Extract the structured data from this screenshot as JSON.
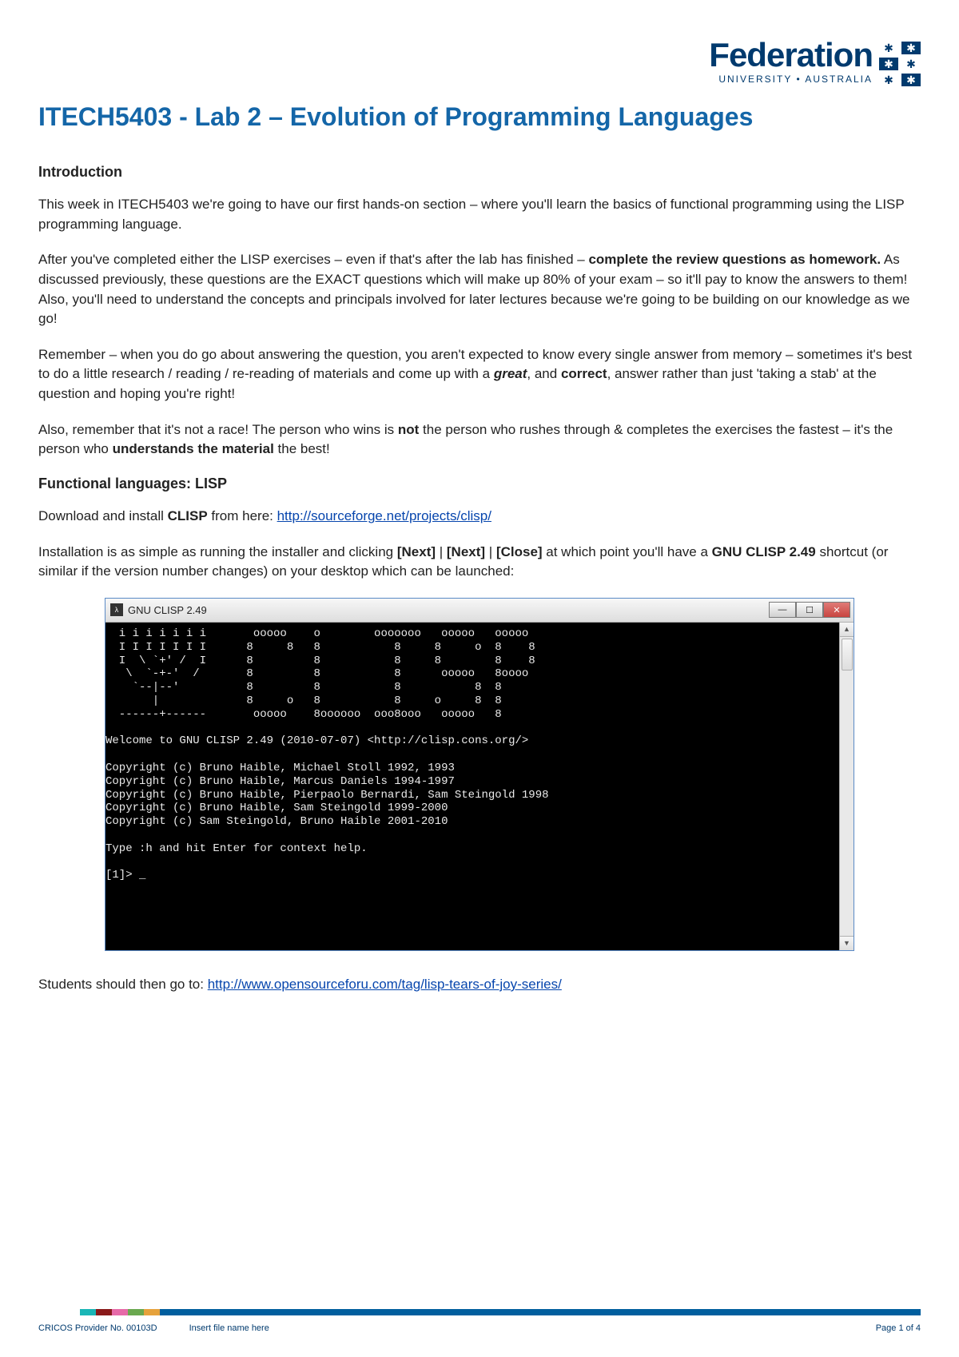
{
  "logo": {
    "main": "Federation",
    "sub": "UNIVERSITY • AUSTRALIA"
  },
  "title": "ITECH5403 - Lab 2 – Evolution of Programming Languages",
  "sections": {
    "intro_heading": "Introduction",
    "intro_p1": "This week in ITECH5403 we're going to have our first hands-on section – where you'll learn the basics of functional programming using the LISP programming language.",
    "intro_p2a": "After you've completed either the LISP exercises – even if that's after the lab has finished – ",
    "intro_p2b": "complete the review questions as homework.",
    "intro_p2c": " As discussed previously, these questions are the EXACT questions which will make up 80% of your exam – so it'll pay to know the answers to them! Also, you'll need to understand the concepts and principals involved for later lectures because we're going to be building on our knowledge as we go!",
    "intro_p3a": "Remember – when you do go about answering the question, you aren't expected to know every single answer from memory – sometimes it's best to do a little research / reading / re-reading of materials and come up with a ",
    "intro_p3b": "great",
    "intro_p3c": ", and ",
    "intro_p3d": "correct",
    "intro_p3e": ", answer rather than just 'taking a stab' at the question and hoping you're right!",
    "intro_p4a": "Also, remember that it's not a race! The person who wins is ",
    "intro_p4b": "not",
    "intro_p4c": " the person who rushes through & completes the exercises the fastest – it's the person who ",
    "intro_p4d": "understands the material",
    "intro_p4e": " the best!",
    "func_heading": "Functional languages: LISP",
    "dl_a": "Download and install ",
    "dl_b": "CLISP",
    "dl_c": " from here: ",
    "dl_link": "http://sourceforge.net/projects/clisp/",
    "install_a": "Installation is as simple as running the installer and clicking ",
    "install_b": "[Next]",
    "install_c": " | ",
    "install_d": "[Next]",
    "install_e": " | ",
    "install_f": "[Close]",
    "install_g": " at which point you'll have a ",
    "install_h": "GNU CLISP 2.49",
    "install_i": " shortcut (or similar if the version number changes) on your desktop which can be launched:",
    "students_a": "Students should then go to: ",
    "students_link": "http://www.opensourceforu.com/tag/lisp-tears-of-joy-series/"
  },
  "terminal": {
    "title": "GNU CLISP 2.49",
    "content": "  i i i i i i i       ooooo    o        ooooooo   ooooo   ooooo\n  I I I I I I I      8     8   8           8     8     o  8    8\n  I  \\ `+' /  I      8         8           8     8        8    8\n   \\  `-+-'  /       8         8           8      ooooo   8oooo\n    `--|--'          8         8           8           8  8\n       |             8     o   8           8     o     8  8\n  ------+------       ooooo    8oooooo  ooo8ooo   ooooo   8\n\nWelcome to GNU CLISP 2.49 (2010-07-07) <http://clisp.cons.org/>\n\nCopyright (c) Bruno Haible, Michael Stoll 1992, 1993\nCopyright (c) Bruno Haible, Marcus Daniels 1994-1997\nCopyright (c) Bruno Haible, Pierpaolo Bernardi, Sam Steingold 1998\nCopyright (c) Bruno Haible, Sam Steingold 1999-2000\nCopyright (c) Sam Steingold, Bruno Haible 2001-2010\n\nType :h and hit Enter for context help.\n\n[1]> _\n\n\n\n"
  },
  "footer": {
    "cricos": "CRICOS Provider No. 00103D",
    "filename": "Insert file name here",
    "page": "Page 1 of 4"
  }
}
